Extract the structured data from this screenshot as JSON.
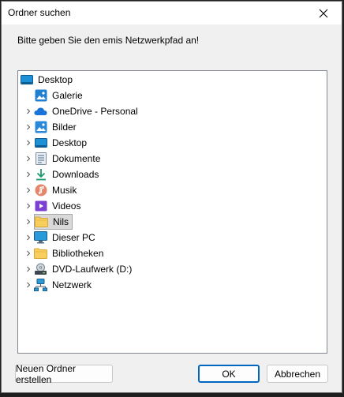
{
  "window": {
    "title": "Ordner suchen"
  },
  "instruction": "Bitte geben Sie den emis Netzwerkpfad an!",
  "tree": {
    "root": {
      "label": "Desktop",
      "icon": "desktop-icon"
    },
    "items": [
      {
        "label": "Galerie",
        "icon": "gallery-icon",
        "expandable": false
      },
      {
        "label": "OneDrive - Personal",
        "icon": "onedrive-cloud-icon",
        "expandable": true
      },
      {
        "label": "Bilder",
        "icon": "pictures-folder-icon",
        "expandable": true
      },
      {
        "label": "Desktop",
        "icon": "desktop-folder-icon",
        "expandable": true
      },
      {
        "label": "Dokumente",
        "icon": "documents-icon",
        "expandable": true
      },
      {
        "label": "Downloads",
        "icon": "download-arrow-icon",
        "expandable": true
      },
      {
        "label": "Musik",
        "icon": "music-icon",
        "expandable": true
      },
      {
        "label": "Videos",
        "icon": "videos-icon",
        "expandable": true
      },
      {
        "label": "Nils",
        "icon": "folder-icon",
        "expandable": true,
        "selected": true
      },
      {
        "label": "Dieser PC",
        "icon": "this-pc-icon",
        "expandable": true
      },
      {
        "label": "Bibliotheken",
        "icon": "libraries-folder-icon",
        "expandable": true
      },
      {
        "label": "DVD-Laufwerk (D:)",
        "icon": "dvd-drive-icon",
        "expandable": true
      },
      {
        "label": "Netzwerk",
        "icon": "network-icon",
        "expandable": true
      }
    ]
  },
  "buttons": {
    "new_folder": "Neuen Ordner erstellen",
    "ok": "OK",
    "cancel": "Abbrechen"
  },
  "colors": {
    "accent": "#0067c0",
    "selection_bg": "#d9d9d9"
  }
}
